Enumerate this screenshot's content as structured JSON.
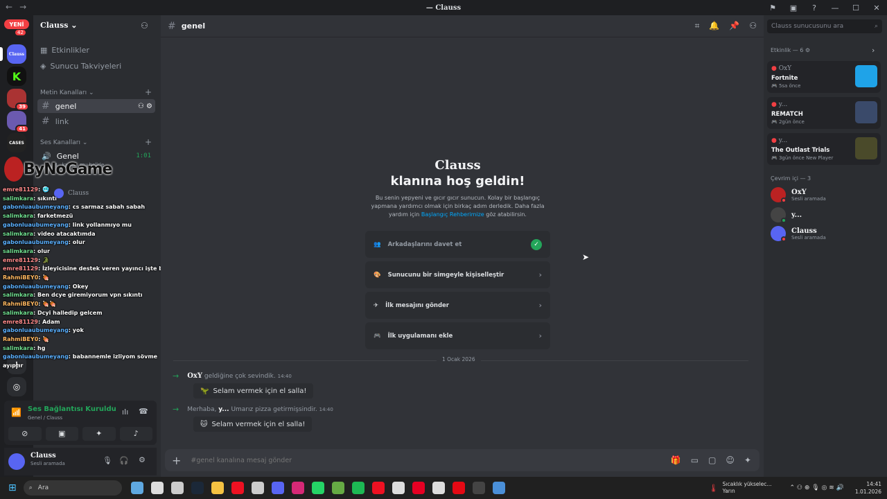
{
  "window": {
    "title": "Clauss"
  },
  "servers": {
    "new_label": "YENİ",
    "new_badge": "42",
    "badges": [
      "39",
      "41"
    ],
    "cases_label": "CASES"
  },
  "sidebar": {
    "server_name": "Clauss",
    "events": "Etkinlikler",
    "boosts": "Sunucu Takviyeleri",
    "text_category": "Metin Kanalları",
    "text_channels": [
      "genel",
      "link"
    ],
    "voice_category": "Ses Kanalları",
    "voice_channel": "Genel",
    "voice_time": "1:01",
    "voice_sub": "B...kanal...mu belirle",
    "voice_member": "Clauss"
  },
  "overlay": {
    "logo_text": "ByNoGame",
    "chat": [
      {
        "user": "emre81129",
        "text": "",
        "emoji": "🥶"
      },
      {
        "user": "salimkara",
        "text": "sıkıntı"
      },
      {
        "user": "gabonluaubumeyang",
        "text": "cs sarmaz sabah sabah"
      },
      {
        "user": "salimkara",
        "text": "farketmezü"
      },
      {
        "user": "gabonluaubumeyang",
        "text": "link yollanmıyo mu"
      },
      {
        "user": "salimkara",
        "text": "video atacaktımda"
      },
      {
        "user": "gabonluaubumeyang",
        "text": "olur"
      },
      {
        "user": "salimkara",
        "text": "olur"
      },
      {
        "user": "emre81129",
        "text": "",
        "emoji": "🐊"
      },
      {
        "user": "emre81129",
        "text": "İzleyicisine destek veren yayıncı işte bu"
      },
      {
        "user": "RahmiBEY0",
        "text": "",
        "emoji": "🍖"
      },
      {
        "user": "gabonluaubumeyang",
        "text": "Okey"
      },
      {
        "user": "salimkara",
        "text": "Ben dcye giremiyorum vpn sıkıntı"
      },
      {
        "user": "RahmiBEY0",
        "text": "",
        "emoji": "🍖🍖"
      },
      {
        "user": "salimkara",
        "text": "Dcyi halledip gelcem"
      },
      {
        "user": "emre81129",
        "text": "Adam"
      },
      {
        "user": "gabonluaubumeyang",
        "text": "yok"
      },
      {
        "user": "RahmiBEY0",
        "text": "",
        "emoji": "🍖"
      },
      {
        "user": "salimkara",
        "text": "hg"
      },
      {
        "user": "gabonluaubumeyang",
        "text": "babannemle izliyom sövme ayıptır"
      }
    ]
  },
  "voice_panel": {
    "status": "Ses Bağlantısı Kuruldu",
    "sub": "Genel / Clauss"
  },
  "user_panel": {
    "name": "Clauss",
    "status": "Sesli aramada"
  },
  "main": {
    "channel": "genel",
    "welcome_name": "Clauss",
    "welcome_title": "klanına hoş geldin!",
    "welcome_text_1": "Bu senin yepyeni ve gıcır gıcır sunucun. Kolay bir başlangıç yapmana yardımcı olmak için birkaç adım derledik. Daha fazla yardım için",
    "welcome_link": "Başlangıç Rehberimize",
    "welcome_text_2": "göz atabilirsin.",
    "actions": [
      "Arkadaşlarını davet et",
      "Sunucunu bir simgeyle kişiselleştir",
      "İlk mesajını gönder",
      "İlk uygulamanı ekle"
    ],
    "date_divider": "1 Ocak 2026",
    "messages": [
      {
        "user": "OxY",
        "text": "geldiğine çok sevindik.",
        "time": "14:40",
        "prefix": ""
      },
      {
        "user": "y...",
        "text": "Umarız pizza getirmişsindir.",
        "time": "14:40",
        "prefix": "Merhaba,"
      }
    ],
    "wave_label": "Selam vermek için el salla!",
    "input_placeholder": "#genel kanalına mesaj gönder"
  },
  "right": {
    "search_placeholder": "Clauss sunucusunu ara",
    "activity_header": "Etkinlik — 6",
    "activities": [
      {
        "who": "OxY",
        "game": "Fortnite",
        "meta": "5sa önce",
        "extra": "",
        "color": "#1fa3e8"
      },
      {
        "who": "y...",
        "game": "REMATCH",
        "meta": "2gün önce",
        "extra": "",
        "color": "#3a4a6a"
      },
      {
        "who": "y...",
        "game": "The Outlast Trials",
        "meta": "3gün önce",
        "extra": "New Player",
        "color": "#4a4a2a"
      }
    ],
    "online_header": "Çevrim içi — 3",
    "members": [
      {
        "name": "OxY",
        "status": "Sesli aramada"
      },
      {
        "name": "y...",
        "status": ""
      },
      {
        "name": "Clauss",
        "status": "Sesli aramada"
      }
    ]
  },
  "taskbar": {
    "search": "Ara",
    "weather": "Sıcaklık yükselec...",
    "weather_sub": "Yarın",
    "time": "14:41",
    "date": "1.01.2026"
  },
  "colors": {
    "accent": "#5865f2",
    "green": "#23a55a",
    "red": "#f23f43",
    "link": "#00a8fc"
  }
}
